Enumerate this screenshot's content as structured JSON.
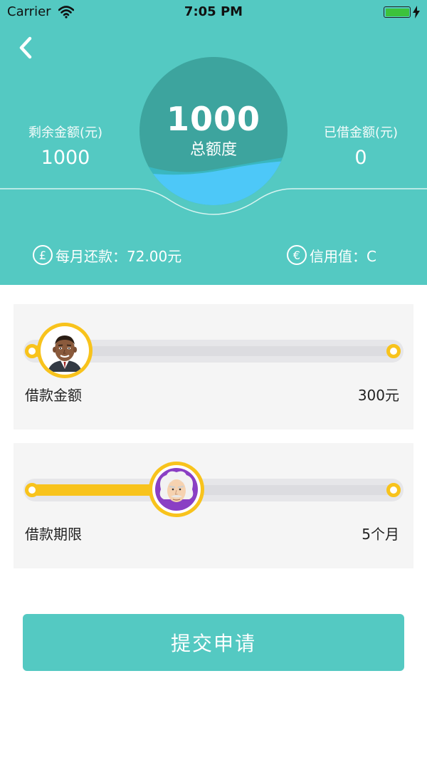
{
  "status_bar": {
    "carrier": "Carrier",
    "time": "7:05 PM",
    "battery_icon": "battery-icon",
    "wifi_icon": "wifi-icon"
  },
  "header": {
    "back_icon": "chevron-left-icon",
    "remaining": {
      "label": "剩余金额(元)",
      "value": "1000"
    },
    "borrowed": {
      "label": "已借金额(元)",
      "value": "0"
    },
    "gauge": {
      "amount": "1000",
      "label": "总额度",
      "fill_fraction": 0.28
    },
    "monthly_payment": {
      "icon": "pound-icon",
      "text": "每月还款：72.00元"
    },
    "credit": {
      "icon": "euro-icon",
      "text": "信用值：C"
    }
  },
  "sliders": [
    {
      "label": "借款金额",
      "value": "300元",
      "fraction": 0.09,
      "avatar": "obama-avatar"
    },
    {
      "label": "借款期限",
      "value": "5个月",
      "fraction": 0.4,
      "avatar": "einstein-avatar"
    }
  ],
  "submit_label": "提交申请",
  "colors": {
    "primary": "#54c9c2",
    "accent": "#f8c31c",
    "gauge_dark": "#3da49e",
    "wave": "#4dc8f8"
  }
}
